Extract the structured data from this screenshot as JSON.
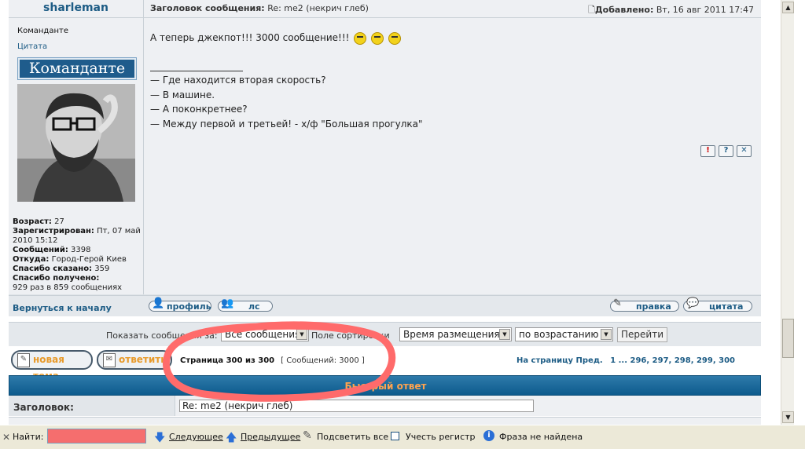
{
  "post": {
    "author": "sharleman",
    "subject_label": "Заголовок сообщения:",
    "subject": "Re: me2 (некрич глеб)",
    "added_label": "Добавлено:",
    "added": "Вт, 16 авг 2011 17:47",
    "rank": "Команданте",
    "quote_link": "Цитата",
    "rank_image_text": "Команданте",
    "stats": [
      {
        "label": "Возраст:",
        "value": "27"
      },
      {
        "label": "Зарегистрирован:",
        "value": "Пт, 07 май 2010 15:12"
      },
      {
        "label": "Сообщений:",
        "value": "3398"
      },
      {
        "label": "Откуда:",
        "value": "Город-Герой Киев"
      },
      {
        "label": "Спасибо сказано:",
        "value": "359"
      },
      {
        "label": "Спасибо получено:",
        "value": "929 раз в 859 сообщениях"
      }
    ],
    "message": "А теперь джекпот!!! 3000 сообщение!!!",
    "signature": [
      "— Где находится вторая скорость?",
      "— В машине.",
      "— А поконкретнее?",
      "— Между первой и третьей! - х/ф \"Большая прогулка\""
    ],
    "back_to_top": "Вернуться к началу",
    "profile_label": "профиль",
    "pm_label": "лс",
    "edit_label": "правка",
    "quote_label": "цитата",
    "icons": [
      "report-icon",
      "info-icon",
      "delete-icon"
    ]
  },
  "sortbar": {
    "show_label": "Показать сообщения за:",
    "period": "Все сообщения",
    "sort_label": "Поле сортировки",
    "sort_field": "Время размещения",
    "sort_order": "по возрастанию",
    "go_label": "Перейти"
  },
  "actions": {
    "new_topic": "новая тема",
    "reply": "ответить"
  },
  "pagination": {
    "page_text": "Страница 300 из 300",
    "message_count": "[ Сообщений: 3000 ]",
    "nav_prefix": "На страницу Пред.",
    "pages": "1 ... 296, 297, 298, 299, 300"
  },
  "quick_reply": {
    "title": "Быстрый ответ",
    "subject_label": "Заголовок:",
    "subject_value": "Re: me2 (некрич глеб)"
  },
  "findbar": {
    "close": "✕",
    "label": "Найти:",
    "next": "Следующее",
    "prev": "Предыдущее",
    "highlight": "Подсветить все",
    "match_case": "Учесть регистр",
    "status": "Фраза не найдена"
  },
  "colors": {
    "marker": "#ff6b6b",
    "header_blue": "#0d5b8d",
    "accent_orange": "#ffa34f"
  }
}
